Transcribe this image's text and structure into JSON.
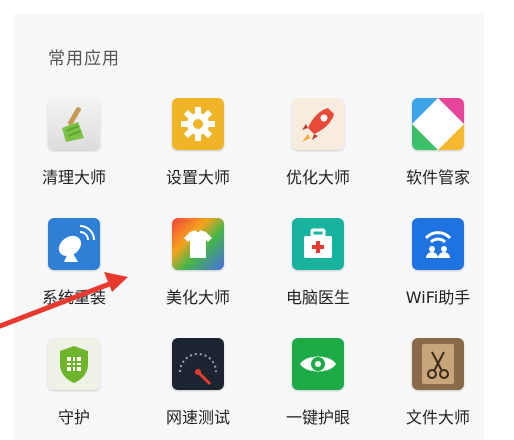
{
  "section": {
    "title": "常用应用"
  },
  "apps": [
    {
      "label": "清理大师",
      "icon": "broom-icon"
    },
    {
      "label": "设置大师",
      "icon": "gear-icon"
    },
    {
      "label": "优化大师",
      "icon": "rocket-icon"
    },
    {
      "label": "软件管家",
      "icon": "software-manager-icon"
    },
    {
      "label": "系统重装",
      "icon": "satellite-dish-icon"
    },
    {
      "label": "美化大师",
      "icon": "tshirt-icon"
    },
    {
      "label": "电脑医生",
      "icon": "medical-kit-icon"
    },
    {
      "label": "WiFi助手",
      "icon": "wifi-users-icon"
    },
    {
      "label": "守护",
      "icon": "shield-icon"
    },
    {
      "label": "网速测试",
      "icon": "speedometer-icon"
    },
    {
      "label": "一键护眼",
      "icon": "eye-icon"
    },
    {
      "label": "文件大师",
      "icon": "folder-scissors-icon"
    }
  ],
  "colors": {
    "annotation_arrow": "#e8392e"
  }
}
